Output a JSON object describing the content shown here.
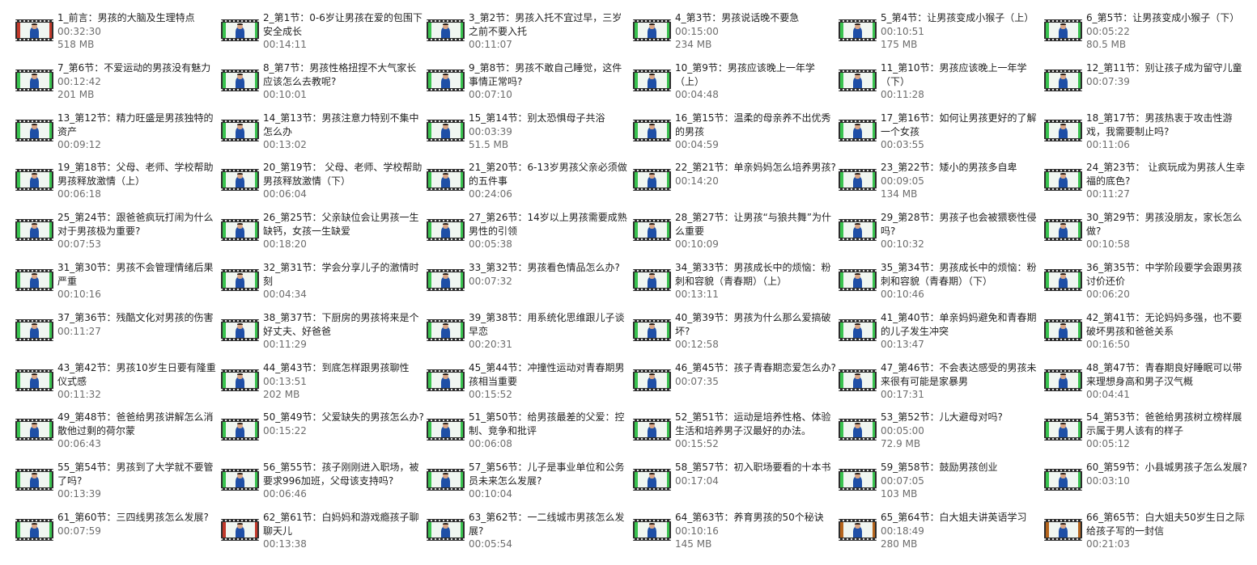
{
  "files": [
    {
      "title": "1_前言：男孩的大脑及生理特点",
      "duration": "00:32:30",
      "size": "518 MB",
      "thumb": "red"
    },
    {
      "title": "2_第1节：0-6岁让男孩在爱的包围下安全成长",
      "duration": "00:14:11",
      "size": ""
    },
    {
      "title": "3_第2节：男孩入托不宜过早，三岁之前不要入托",
      "duration": "00:11:07",
      "size": ""
    },
    {
      "title": "4_第3节：男孩说话晚不要急",
      "duration": "00:15:00",
      "size": "234 MB"
    },
    {
      "title": "5_第4节：让男孩变成小猴子（上）",
      "duration": "00:10:51",
      "size": "175 MB"
    },
    {
      "title": "6_第5节：让男孩变成小猴子（下）",
      "duration": "00:05:22",
      "size": "80.5 MB"
    },
    {
      "title": "7_第6节：不爱运动的男孩没有魅力",
      "duration": "00:12:42",
      "size": "201 MB"
    },
    {
      "title": "8_第7节：男孩性格扭捏不大气家长应该怎么去教呢?",
      "duration": "00:10:01",
      "size": ""
    },
    {
      "title": "9_第8节：男孩不敢自己睡觉，这件事情正常吗?",
      "duration": "00:07:10",
      "size": ""
    },
    {
      "title": "10_第9节：男孩应该晚上一年学（上）",
      "duration": "00:04:48",
      "size": ""
    },
    {
      "title": "11_第10节：男孩应该晚上一年学（下）",
      "duration": "00:11:28",
      "size": ""
    },
    {
      "title": "12_第11节：别让孩子成为留守儿童",
      "duration": "00:07:39",
      "size": ""
    },
    {
      "title": "13_第12节：精力旺盛是男孩独特的资产",
      "duration": "00:09:12",
      "size": ""
    },
    {
      "title": "14_第13节：男孩注意力特别不集中怎么办",
      "duration": "00:13:02",
      "size": ""
    },
    {
      "title": "15_第14节：别太恐惧母子共浴",
      "duration": "00:03:39",
      "size": "51.5 MB"
    },
    {
      "title": "16_第15节：温柔的母亲养不出优秀的男孩",
      "duration": "00:04:59",
      "size": ""
    },
    {
      "title": "17_第16节：如何让男孩更好的了解一个女孩",
      "duration": "00:03:55",
      "size": ""
    },
    {
      "title": "18_第17节：男孩热衷于攻击性游戏，我需要制止吗?",
      "duration": "00:11:06",
      "size": ""
    },
    {
      "title": "19_第18节：父母、老师、学校帮助男孩释放激情（上）",
      "duration": "00:06:18",
      "size": ""
    },
    {
      "title": "20_第19节：  父母、老师、学校帮助男孩释放激情（下）",
      "duration": "00:06:04",
      "size": ""
    },
    {
      "title": "21_第20节：6-13岁男孩父亲必须做的五件事",
      "duration": "00:24:06",
      "size": ""
    },
    {
      "title": "22_第21节：单亲妈妈怎么培养男孩?",
      "duration": "00:14:20",
      "size": ""
    },
    {
      "title": "23_第22节：矮小的男孩多自卑",
      "duration": "00:09:05",
      "size": "134 MB"
    },
    {
      "title": "24_第23节：  让疯玩成为男孩人生幸福的底色?",
      "duration": "00:11:27",
      "size": ""
    },
    {
      "title": "25_第24节：跟爸爸疯玩打闹为什么对于男孩极为重要?",
      "duration": "00:07:53",
      "size": ""
    },
    {
      "title": "26_第25节：父亲缺位会让男孩一生缺钙，女孩一生缺爱",
      "duration": "00:18:20",
      "size": ""
    },
    {
      "title": "27_第26节：14岁以上男孩需要成熟男性的引领",
      "duration": "00:05:38",
      "size": ""
    },
    {
      "title": "28_第27节：让男孩“与狼共舞”为什么重要",
      "duration": "00:10:09",
      "size": ""
    },
    {
      "title": "29_第28节：男孩子也会被猥亵性侵吗?",
      "duration": "00:10:32",
      "size": ""
    },
    {
      "title": "30_第29节：男孩没朋友，家长怎么做?",
      "duration": "00:10:58",
      "size": ""
    },
    {
      "title": "31_第30节：男孩不会管理情绪后果严重",
      "duration": "00:10:16",
      "size": ""
    },
    {
      "title": "32_第31节：学会分享儿子的激情时刻",
      "duration": "00:04:34",
      "size": ""
    },
    {
      "title": "33_第32节：男孩看色情品怎么办?",
      "duration": "00:07:32",
      "size": ""
    },
    {
      "title": "34_第33节：男孩成长中的烦恼：粉刺和容貌（青春期）（上）",
      "duration": "00:13:11",
      "size": ""
    },
    {
      "title": "35_第34节：男孩成长中的烦恼：粉刺和容貌（青春期）（下）",
      "duration": "00:10:46",
      "size": ""
    },
    {
      "title": "36_第35节：中学阶段要学会跟男孩讨价还价",
      "duration": "00:06:20",
      "size": ""
    },
    {
      "title": "37_第36节：残酷文化对男孩的伤害",
      "duration": "00:11:27",
      "size": ""
    },
    {
      "title": "38_第37节：下厨房的男孩将来是个好丈夫、好爸爸",
      "duration": "00:11:29",
      "size": ""
    },
    {
      "title": "39_第38节：用系统化思维跟儿子谈早恋",
      "duration": "00:20:31",
      "size": ""
    },
    {
      "title": "40_第39节：男孩为什么那么爱搞破坏?",
      "duration": "00:12:58",
      "size": ""
    },
    {
      "title": "41_第40节：单亲妈妈避免和青春期的儿子发生冲突",
      "duration": "00:13:47",
      "size": ""
    },
    {
      "title": "42_第41节：无论妈妈多强，也不要破坏男孩和爸爸关系",
      "duration": "00:16:50",
      "size": ""
    },
    {
      "title": "43_第42节：男孩10岁生日要有隆重仪式感",
      "duration": "00:11:32",
      "size": ""
    },
    {
      "title": "44_第43节：到底怎样跟男孩聊性",
      "duration": "00:13:51",
      "size": "202 MB"
    },
    {
      "title": "45_第44节：冲撞性运动对青春期男孩相当重要",
      "duration": "00:15:52",
      "size": ""
    },
    {
      "title": "46_第45节：孩子青春期恋爱怎么办?",
      "duration": "00:07:35",
      "size": ""
    },
    {
      "title": "47_第46节：不会表达感受的男孩未来很有可能是家暴男",
      "duration": "00:17:31",
      "size": ""
    },
    {
      "title": "48_第47节：青春期良好睡眠可以带来理想身高和男子汉气概",
      "duration": "00:04:41",
      "size": ""
    },
    {
      "title": "49_第48节：爸爸给男孩讲解怎么消散他过剩的荷尔蒙",
      "duration": "00:06:43",
      "size": ""
    },
    {
      "title": "50_第49节：父爱缺失的男孩怎么办?",
      "duration": "00:15:22",
      "size": ""
    },
    {
      "title": "51_第50节：给男孩最差的父爱：控制、竞争和批评",
      "duration": "00:06:08",
      "size": ""
    },
    {
      "title": "52_第51节：运动是培养性格、体验生活和培养男子汉最好的办法。",
      "duration": "00:15:52",
      "size": ""
    },
    {
      "title": "53_第52节：儿大避母对吗?",
      "duration": "00:05:00",
      "size": "72.9 MB"
    },
    {
      "title": "54_第53节：爸爸给男孩树立榜样展示属于男人该有的样子",
      "duration": "00:05:12",
      "size": ""
    },
    {
      "title": "55_第54节：男孩到了大学就不要管了吗?",
      "duration": "00:13:39",
      "size": ""
    },
    {
      "title": "56_第55节：孩子刚刚进入职场，被要求996加班，父母该支持吗?",
      "duration": "00:06:46",
      "size": ""
    },
    {
      "title": "57_第56节：儿子是事业单位和公务员未来怎么发展?",
      "duration": "00:10:04",
      "size": ""
    },
    {
      "title": "58_第57节：初入职场要看的十本书",
      "duration": "00:17:04",
      "size": ""
    },
    {
      "title": "59_第58节：鼓励男孩创业",
      "duration": "00:07:05",
      "size": "103 MB"
    },
    {
      "title": "60_第59节：小县城男孩子怎么发展?",
      "duration": "00:03:10",
      "size": ""
    },
    {
      "title": "61_第60节：三四线男孩怎么发展?",
      "duration": "00:07:59",
      "size": ""
    },
    {
      "title": "62_第61节：白妈妈和游戏瘾孩子聊聊天儿",
      "duration": "00:13:38",
      "size": "",
      "thumb": "red"
    },
    {
      "title": "63_第62节：一二线城市男孩怎么发展?",
      "duration": "00:05:54",
      "size": ""
    },
    {
      "title": "64_第63节：养育男孩的50个秘诀",
      "duration": "00:10:16",
      "size": "145 MB"
    },
    {
      "title": "65_第64节：白大姐夫讲英语学习",
      "duration": "00:18:49",
      "size": "280 MB",
      "thumb": "orange"
    },
    {
      "title": "66_第65节：白大姐夫50岁生日之际给孩子写的一封信",
      "duration": "00:21:03",
      "size": "",
      "thumb": "orange"
    }
  ]
}
